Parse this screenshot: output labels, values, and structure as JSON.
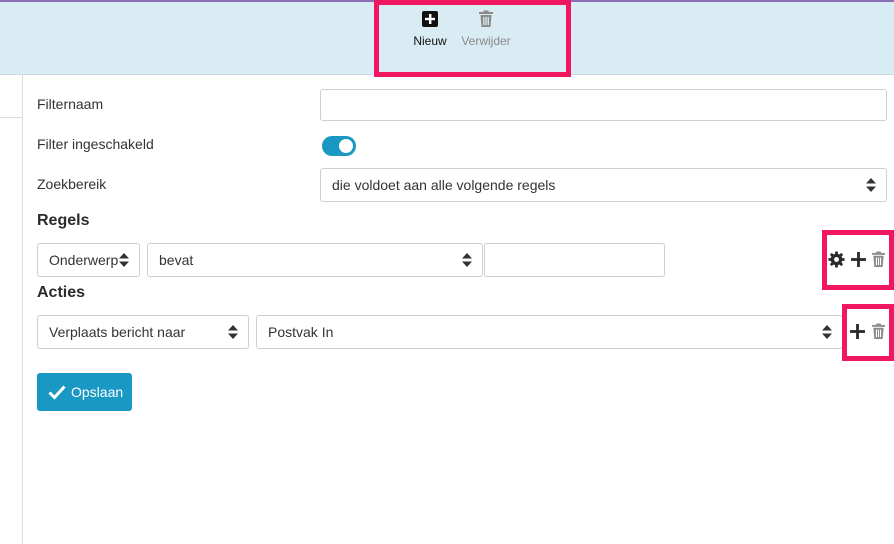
{
  "toolbar": {
    "new_label": "Nieuw",
    "delete_label": "Verwijder"
  },
  "form": {
    "filtername_label": "Filternaam",
    "filtername_value": "",
    "enabled_label": "Filter ingeschakeld",
    "enabled": true,
    "scope_label": "Zoekbereik",
    "scope_value": "die voldoet aan alle volgende regels"
  },
  "rules": {
    "heading": "Regels",
    "field_value": "Onderwerp",
    "operator_value": "bevat",
    "text_value": ""
  },
  "actions": {
    "heading": "Acties",
    "action_value": "Verplaats bericht naar",
    "target_value": "Postvak In"
  },
  "save_label": "Opslaan",
  "colors": {
    "accent": "#1a98c4",
    "toolbar_bg": "#d9ebf3",
    "highlight": "#f0165f"
  },
  "icons": {
    "new": "plus-square-icon",
    "delete": "trash-icon",
    "settings": "gear-icon",
    "add": "plus-icon",
    "save": "check-icon",
    "select": "sort-arrows-icon"
  }
}
